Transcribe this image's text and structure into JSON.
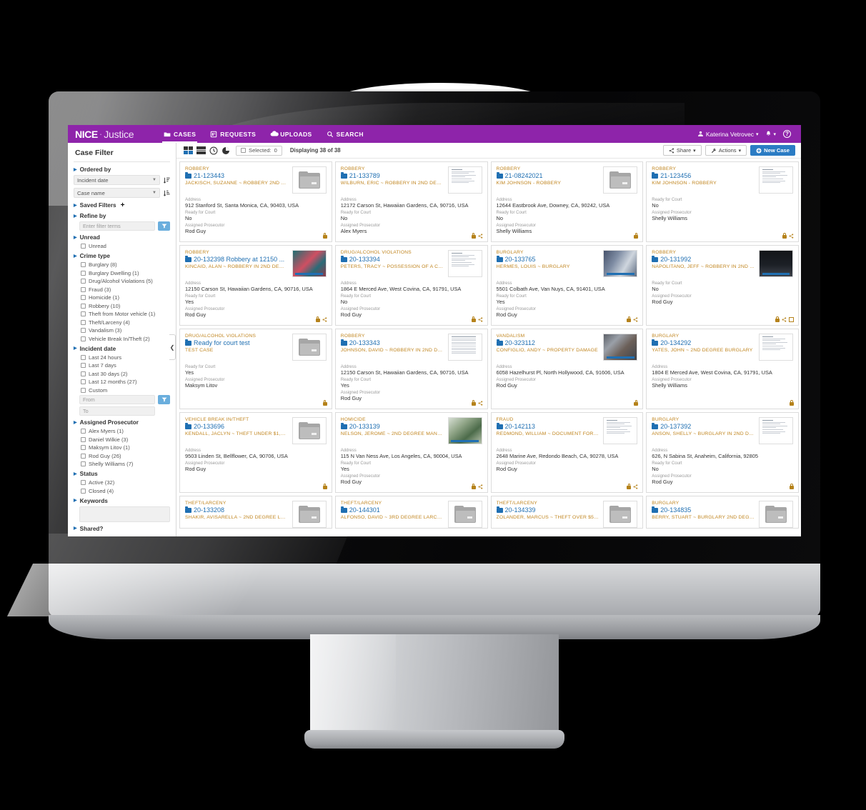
{
  "app": {
    "brand_primary": "NICE",
    "brand_sep": "·",
    "brand_secondary": "Justice",
    "accent_purple": "#8e24aa",
    "accent_blue": "#1f6fb2",
    "accent_orange": "#c0851f"
  },
  "nav": {
    "items": [
      {
        "label": "CASES",
        "icon": "folder-icon",
        "active": true
      },
      {
        "label": "REQUESTS",
        "icon": "clipboard-icon",
        "active": false
      },
      {
        "label": "UPLOADS",
        "icon": "cloud-icon",
        "active": false
      },
      {
        "label": "SEARCH",
        "icon": "search-icon",
        "active": false
      }
    ]
  },
  "account": {
    "user_name": "Katerina Vetrovec",
    "user_caret": "▾",
    "bell_icon": "bell-icon",
    "bell_caret": "▾",
    "help_label": "?"
  },
  "sidebar": {
    "title": "Case Filter",
    "ordered_by": {
      "heading": "Ordered by",
      "primary_value": "Incident date",
      "secondary_value": "Case name"
    },
    "saved_filters": {
      "heading": "Saved Filters",
      "add_label": "+"
    },
    "refine_by": {
      "heading": "Refine by",
      "placeholder": "Enter filter terms",
      "value": ""
    },
    "unread": {
      "heading": "Unread",
      "options": [
        {
          "label": "Unread",
          "checked": false
        }
      ]
    },
    "crime_type": {
      "heading": "Crime type",
      "options": [
        {
          "label": "Burglary (8)",
          "checked": false
        },
        {
          "label": "Burglary Dwelling (1)",
          "checked": false
        },
        {
          "label": "Drug/Alcohol Violations (5)",
          "checked": false
        },
        {
          "label": "Fraud (3)",
          "checked": false
        },
        {
          "label": "Homicide (1)",
          "checked": false
        },
        {
          "label": "Robbery (10)",
          "checked": false
        },
        {
          "label": "Theft from Motor vehicle (1)",
          "checked": false
        },
        {
          "label": "Theft/Larceny (4)",
          "checked": false
        },
        {
          "label": "Vandalism (3)",
          "checked": false
        },
        {
          "label": "Vehicle Break In/Theft (2)",
          "checked": false
        }
      ]
    },
    "incident_date": {
      "heading": "Incident date",
      "options": [
        {
          "label": "Last 24 hours",
          "checked": false
        },
        {
          "label": "Last 7 days",
          "checked": false
        },
        {
          "label": "Last 30 days (2)",
          "checked": false
        },
        {
          "label": "Last 12 months (27)",
          "checked": false
        },
        {
          "label": "Custom",
          "checked": false
        }
      ],
      "from_placeholder": "From",
      "to_placeholder": "To"
    },
    "assigned_prosecutor": {
      "heading": "Assigned Prosecutor",
      "options": [
        {
          "label": "Alex Myers (1)",
          "checked": false
        },
        {
          "label": "Daniel Wilkie (3)",
          "checked": false
        },
        {
          "label": "Maksym Litov (1)",
          "checked": false
        },
        {
          "label": "Rod Guy (26)",
          "checked": false
        },
        {
          "label": "Shelly Williams (7)",
          "checked": false
        }
      ]
    },
    "status": {
      "heading": "Status",
      "options": [
        {
          "label": "Active (32)",
          "checked": false
        },
        {
          "label": "Closed (4)",
          "checked": false
        }
      ]
    },
    "keywords": {
      "heading": "Keywords",
      "value": ""
    },
    "shared": {
      "heading": "Shared?"
    },
    "collapse_icon": "chevron-left-icon"
  },
  "toolbar": {
    "view_grid_icon": "grid-view-icon",
    "view_list_icon": "list-view-icon",
    "view_timeline_icon": "clock-view-icon",
    "view_chart_icon": "pie-view-icon",
    "selected_label": "Selected:",
    "selected_count": "0",
    "displaying_text": "Displaying 38 of 38",
    "share_label": "Share",
    "share_icon": "share-icon",
    "actions_label": "Actions",
    "actions_icon": "wrench-icon",
    "new_case_label": "New Case",
    "new_case_icon": "plus-circle-icon",
    "caret": "▾"
  },
  "labels": {
    "address": "Address",
    "ready_for_court": "Ready for Court",
    "assigned_prosecutor": "Assigned Prosecutor"
  },
  "cases": [
    {
      "crime_type": "ROBBERY",
      "case_id": "21-123443",
      "subject": "JACKISCH, SUZANNE ~ ROBBERY 2ND DEG...",
      "address": "912 Stanford St, Santa Monica, CA, 90403, USA",
      "ready_for_court": "No",
      "prosecutor": "Rod Guy",
      "thumb": "folder",
      "locked": true,
      "shared": false,
      "expandable": false
    },
    {
      "crime_type": "ROBBERY",
      "case_id": "21-133789",
      "subject": "WILBURN, ERIC ~ ROBBERY IN 2ND DEGREE",
      "address": "12172 Carson St, Hawaiian Gardens, CA, 90716, USA",
      "ready_for_court": "No",
      "prosecutor": "Alex Myers",
      "thumb": "document",
      "locked": true,
      "shared": true,
      "expandable": false
    },
    {
      "crime_type": "ROBBERY",
      "case_id": "21-08242021",
      "subject": "KIM JOHNSON - ROBBERY",
      "address": "12644 Eastbrook Ave, Downey, CA, 90242, USA",
      "ready_for_court": "No",
      "prosecutor": "Shelly Williams",
      "thumb": "folder",
      "locked": true,
      "shared": false,
      "expandable": false
    },
    {
      "crime_type": "ROBBERY",
      "case_id": "21-123456",
      "subject": "KIM JOHNSON - ROBBERY",
      "address": "",
      "ready_for_court": "No",
      "prosecutor": "Shelly Williams",
      "thumb": "document",
      "locked": true,
      "shared": true,
      "expandable": false
    },
    {
      "crime_type": "ROBBERY",
      "case_id": "20-132398 Robbery at 12150 ...",
      "subject": "KINCAID, ALAN ~ ROBBERY IN 2ND DEGREE",
      "address": "12150 Carson St, Hawaiian Gardens, CA, 90716, USA",
      "ready_for_court": "Yes",
      "prosecutor": "Rod Guy",
      "thumb": "video-teal",
      "locked": true,
      "shared": true,
      "expandable": false
    },
    {
      "crime_type": "DRUG/ALCOHOL VIOLATIONS",
      "case_id": "20-133394",
      "subject": "PETERS, TRACY ~ POSSESSION OF A CONT...",
      "address": "1864 E Merced Ave, West Covina, CA, 91791, USA",
      "ready_for_court": "No",
      "prosecutor": "Rod Guy",
      "thumb": "document",
      "locked": true,
      "shared": true,
      "expandable": false
    },
    {
      "crime_type": "BURGLARY",
      "case_id": "20-133765",
      "subject": "HERMES, LOUIS ~ BURGLARY",
      "address": "5501 Colbath Ave, Van Nuys, CA, 91401, USA",
      "ready_for_court": "Yes",
      "prosecutor": "Rod Guy",
      "thumb": "video-room",
      "locked": true,
      "shared": true,
      "expandable": false
    },
    {
      "crime_type": "ROBBERY",
      "case_id": "20-131992",
      "subject": "NAPOLITANO, JEFF ~ ROBBERY IN 2ND DE...",
      "address": "",
      "ready_for_court": "No",
      "prosecutor": "Rod Guy",
      "thumb": "video-dark",
      "locked": true,
      "shared": true,
      "expandable": true
    },
    {
      "crime_type": "DRUG/ALCOHOL VIOLATIONS",
      "case_id": "Ready for court test",
      "subject": "TEST CASE",
      "address": "",
      "ready_for_court": "Yes",
      "prosecutor": "Maksym Litov",
      "thumb": "folder",
      "locked": true,
      "shared": false,
      "expandable": false
    },
    {
      "crime_type": "ROBBERY",
      "case_id": "20-133343",
      "subject": "JOHNSON, DAVID ~ ROBBERY IN 2ND DEG...",
      "address": "12150 Carson St, Hawaiian Gardens, CA, 90716, USA",
      "ready_for_court": "Yes",
      "prosecutor": "Rod Guy",
      "thumb": "document-dense",
      "locked": true,
      "shared": true,
      "expandable": false
    },
    {
      "crime_type": "VANDALISM",
      "case_id": "20-323112",
      "subject": "CONFIGLIO, ANDY ~ PROPERTY DAMAGE",
      "address": "6058 Hazelhurst Pl, North Hollywood, CA, 91606, USA",
      "ready_for_court": "",
      "prosecutor": "Rod Guy",
      "thumb": "video-clutter",
      "locked": true,
      "shared": false,
      "expandable": false
    },
    {
      "crime_type": "BURGLARY",
      "case_id": "20-134292",
      "subject": "YATES, JOHN ~ 2ND DEGREE BURGLARY",
      "address": "1804 E Merced Ave, West Covina, CA, 91791, USA",
      "ready_for_court": "",
      "prosecutor": "Shelly Williams",
      "thumb": "document",
      "locked": true,
      "shared": false,
      "expandable": false
    },
    {
      "crime_type": "VEHICLE BREAK IN/THEFT",
      "case_id": "20-133696",
      "subject": "KENDALL, JACLYN ~ THEFT UNDER $1,500",
      "address": "9503 Linden St, Bellflower, CA, 90706, USA",
      "ready_for_court": "",
      "prosecutor": "Rod Guy",
      "thumb": "folder",
      "locked": true,
      "shared": false,
      "expandable": false
    },
    {
      "crime_type": "HOMICIDE",
      "case_id": "20-133139",
      "subject": "NELSON, JEROME ~ 2ND DEGREE MANSLA...",
      "address": "115 N Van Ness Ave, Los Angeles, CA, 90004, USA",
      "ready_for_court": "Yes",
      "prosecutor": "Rod Guy",
      "thumb": "video-green",
      "locked": true,
      "shared": true,
      "expandable": false
    },
    {
      "crime_type": "FRAUD",
      "case_id": "20-142113",
      "subject": "REDMOND, WILLIAM ~ DOCUMENT FORGE...",
      "address": "2648 Marine Ave, Redondo Beach, CA, 90278, USA",
      "ready_for_court": "",
      "prosecutor": "Rod Guy",
      "thumb": "document",
      "locked": true,
      "shared": true,
      "expandable": false
    },
    {
      "crime_type": "BURGLARY",
      "case_id": "20-137392",
      "subject": "ANSON, SHELLY ~ BURGLARY IN 2ND DEG...",
      "address": "626, N Sabina St, Anaheim, California, 92805",
      "ready_for_court": "No",
      "prosecutor": "Rod Guy",
      "thumb": "document",
      "locked": true,
      "shared": false,
      "expandable": false
    }
  ],
  "cases_partial": [
    {
      "crime_type": "THEFT/LARCENY",
      "case_id": "20-133208",
      "subject": "SHAKIR, AVISARELLA ~ 2ND DEGREE LARC...",
      "thumb": "folder"
    },
    {
      "crime_type": "THEFT/LARCENY",
      "case_id": "20-144301",
      "subject": "ALFONSO, DAVID ~ 3RD DEGREE LARCENY",
      "thumb": "folder"
    },
    {
      "crime_type": "THEFT/LARCENY",
      "case_id": "20-134339",
      "subject": "ZOLANDER, MARCUS ~ THEFT OVER $5,000",
      "thumb": "folder"
    },
    {
      "crime_type": "BURGLARY",
      "case_id": "20-134835",
      "subject": "BERRY, STUART ~ BURGLARY 2ND DEGREE",
      "thumb": "folder"
    }
  ]
}
